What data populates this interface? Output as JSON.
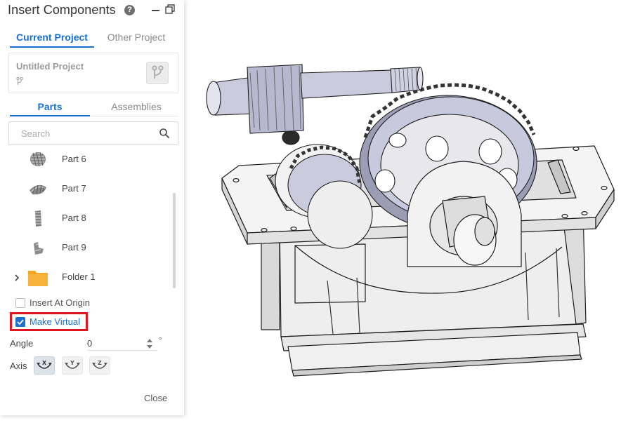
{
  "panel": {
    "title": "Insert Components",
    "help_icon": "question-circle-icon",
    "tabs": [
      {
        "label": "Current Project",
        "active": true
      },
      {
        "label": "Other Project",
        "active": false
      }
    ],
    "project": {
      "name": "Untitled Project",
      "branch_icon": "git-branch-icon"
    },
    "sub_tabs": [
      {
        "label": "Parts",
        "active": true
      },
      {
        "label": "Assemblies",
        "active": false
      }
    ],
    "search": {
      "placeholder": "Search"
    },
    "items": [
      {
        "label": "Part 6",
        "icon": "helical-gear-icon"
      },
      {
        "label": "Part 7",
        "icon": "bevel-gear-icon"
      },
      {
        "label": "Part 8",
        "icon": "gear-segment-icon"
      },
      {
        "label": "Part 9",
        "icon": "bracket-part-icon"
      },
      {
        "label": "Folder 1",
        "icon": "folder-icon"
      }
    ],
    "insert_at_origin": {
      "label": "Insert At Origin",
      "checked": false
    },
    "make_virtual": {
      "label": "Make Virtual",
      "checked": true
    },
    "angle": {
      "label": "Angle",
      "value": "0",
      "unit": "°"
    },
    "axis": {
      "label": "Axis",
      "options": [
        {
          "label": "X",
          "selected": true
        },
        {
          "label": "Y",
          "selected": false
        },
        {
          "label": "Z",
          "selected": false
        }
      ]
    },
    "close_label": "Close"
  },
  "colors": {
    "accent": "#1a6fd1",
    "highlight": "#e0141e",
    "folder": "#f5a623",
    "part_body": "#eeeeee",
    "gear_body": "#c6c8da"
  }
}
